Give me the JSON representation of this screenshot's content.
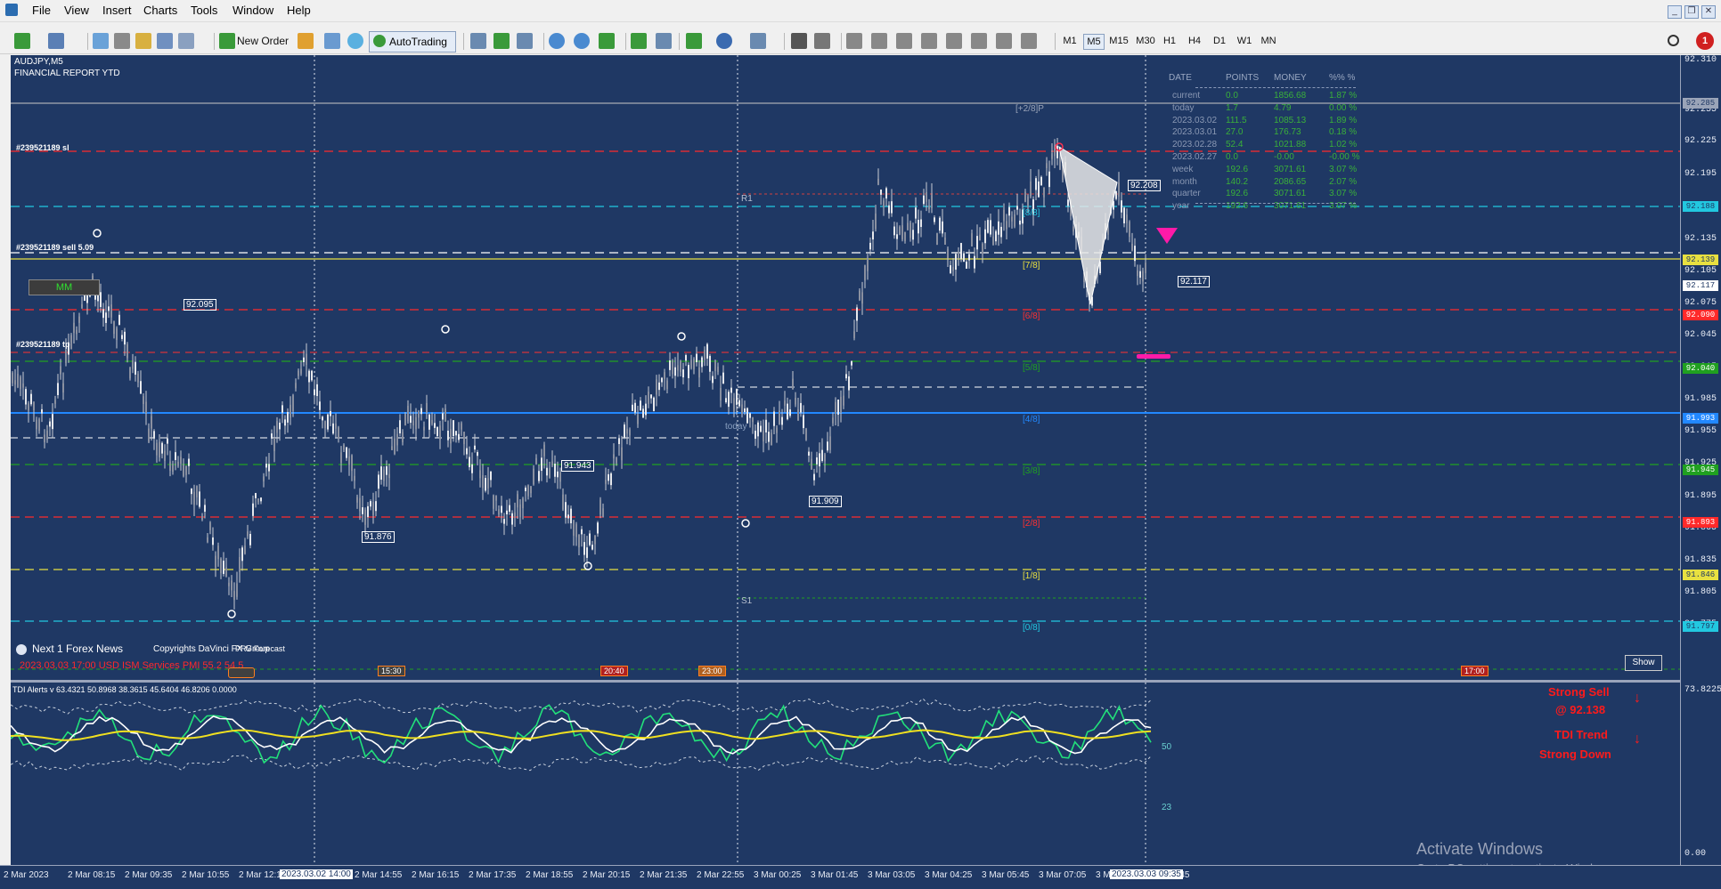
{
  "menu": [
    "File",
    "View",
    "Insert",
    "Charts",
    "Tools",
    "Window",
    "Help"
  ],
  "window_controls": [
    "_",
    "❐",
    "✕"
  ],
  "toolbar": {
    "new_order": "New Order",
    "autotrading": "AutoTrading",
    "timeframes": [
      "M1",
      "M5",
      "M15",
      "M30",
      "H1",
      "H4",
      "D1",
      "W1",
      "MN"
    ],
    "active_timeframe": "M5",
    "notification_count": "1"
  },
  "chart": {
    "symbol": "AUDJPY,M5",
    "indicator_title": "FINANCIAL REPORT YTD",
    "order_sl_label": "#239521189 sl",
    "order_sell_label": "#239521189 sell 5.09",
    "order_tp_label": "#239521189 tp",
    "mm_button": "MM",
    "show_button": "Show",
    "pivot_r1": "R1",
    "pivot_s1": "S1",
    "pivot_today": "today",
    "murrey_labels": [
      "[+2/8]P",
      "[8/8]",
      "[7/8]",
      "[6/8]",
      "[5/8]",
      "[4/8]",
      "[3/8]",
      "[2/8]",
      "[1/8]",
      "[0/8]"
    ],
    "price_boxes": [
      "92.095",
      "91.876",
      "91.943",
      "91.909",
      "92.208",
      "92.117"
    ],
    "news": {
      "title": "Next 1 Forex News",
      "copyright": "Copyrights DaVinci FX Group",
      "forecast": "PRV     Forecast",
      "event": "2023.03.03 17:00   USD  ISM Services PMI    55.2     54.5"
    },
    "event_markers": [
      "15:30",
      "20:40",
      "23:00",
      "17:00"
    ]
  },
  "report_table": {
    "headers": [
      "DATE",
      "POINTS",
      "MONEY",
      "%%  %"
    ],
    "rows": [
      [
        "current",
        "0.0",
        "1856.68",
        "1.87 %"
      ],
      [
        "today",
        "1.7",
        "4.79",
        "0.00 %"
      ],
      [
        "2023.03.02",
        "111.5",
        "1085.13",
        "1.89 %"
      ],
      [
        "2023.03.01",
        "27.0",
        "176.73",
        "0.18 %"
      ],
      [
        "2023.02.28",
        "52.4",
        "1021.88",
        "1.02 %"
      ],
      [
        "2023.02.27",
        "0.0",
        "-0.00",
        "-0.00 %"
      ],
      [
        "week",
        "192.6",
        "3071.61",
        "3.07 %"
      ],
      [
        "month",
        "140.2",
        "2086.65",
        "2.07 %"
      ],
      [
        "quarter",
        "192.6",
        "3071.61",
        "3.07 %"
      ],
      [
        "year",
        "192.6",
        "3071.61",
        "3.07 %"
      ]
    ]
  },
  "price_axis": {
    "ticks": [
      "92.310",
      "92.255",
      "92.225",
      "92.195",
      "92.165",
      "92.135",
      "92.105",
      "92.075",
      "92.045",
      "92.015",
      "91.985",
      "91.955",
      "91.925",
      "91.895",
      "91.865",
      "91.835",
      "91.805",
      "91.775"
    ],
    "labels": [
      "92.285",
      "92.188",
      "92.139",
      "92.117",
      "92.090",
      "92.040",
      "91.993",
      "91.945",
      "91.893",
      "91.846",
      "91.797"
    ],
    "tdi_ticks": [
      "73.8225",
      "0.00"
    ]
  },
  "tdi": {
    "title": "TDI Alerts v 63.4321 50.8968 38.3615 45.6404 46.8206 0.0000",
    "signal_line1": "Strong Sell",
    "signal_line2": "@ 92.138",
    "trend_line1": "TDI Trend",
    "trend_line2": "Strong Down",
    "level_50": "50",
    "level_23": "23"
  },
  "time_axis": {
    "ticks": [
      "2 Mar 2023",
      "2 Mar 08:15",
      "2 Mar 09:35",
      "2 Mar 10:55",
      "2 Mar 12:1",
      "2 Mar 14:55",
      "2 Mar 16:15",
      "2 Mar 17:35",
      "2 Mar 18:55",
      "2 Mar 20:15",
      "2 Mar 21:35",
      "2 Mar 22:55",
      "3 Mar 00:25",
      "3 Mar 01:45",
      "3 Mar 03:05",
      "3 Mar 04:25",
      "3 Mar 05:45",
      "3 Mar 07:05",
      "3 M",
      "9:45"
    ],
    "selected_1": "2023.03.02 14:00",
    "selected_2": "2023.03.03 09:35"
  },
  "activation": {
    "line1": "Activate Windows",
    "line2": "Go to PC settings to activate Windows."
  }
}
